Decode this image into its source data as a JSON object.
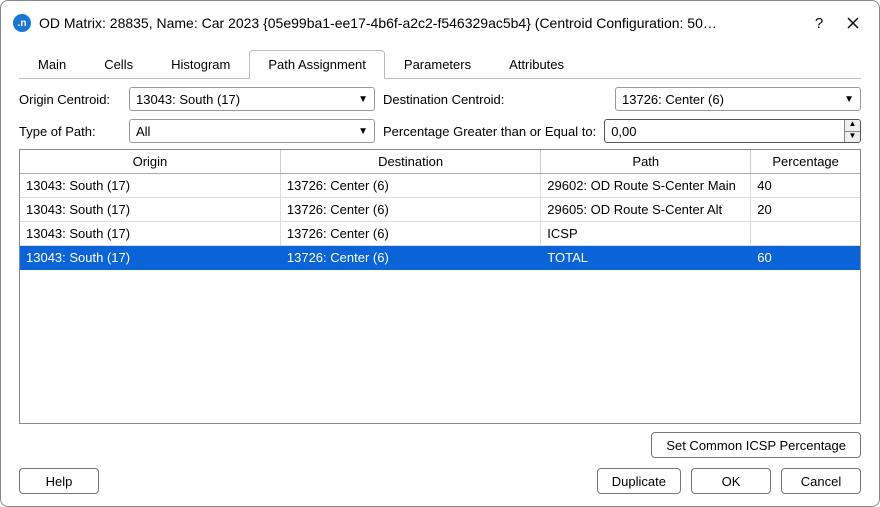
{
  "window": {
    "title": "OD Matrix: 28835, Name: Car 2023  {05e99ba1-ee17-4b6f-a2c2-f546329ac5b4} (Centroid Configuration: 50…"
  },
  "tabs": [
    "Main",
    "Cells",
    "Histogram",
    "Path Assignment",
    "Parameters",
    "Attributes"
  ],
  "activeTab": "Path Assignment",
  "form": {
    "originLabel": "Origin Centroid:",
    "originValue": "13043: South (17)",
    "destLabel": "Destination Centroid:",
    "destValue": "13726: Center (6)",
    "typeLabel": "Type of Path:",
    "typeValue": "All",
    "pctLabel": "Percentage Greater than or Equal to:",
    "pctValue": "0,00"
  },
  "table": {
    "headers": [
      "Origin",
      "Destination",
      "Path",
      "Percentage"
    ],
    "rows": [
      {
        "origin": "13043: South (17)",
        "dest": "13726: Center (6)",
        "path": "29602: OD Route S-Center Main",
        "pct": "40",
        "selected": false
      },
      {
        "origin": "13043: South (17)",
        "dest": "13726: Center (6)",
        "path": "29605: OD Route S-Center Alt",
        "pct": "20",
        "selected": false
      },
      {
        "origin": "13043: South (17)",
        "dest": "13726: Center (6)",
        "path": "ICSP",
        "pct": "",
        "selected": false
      },
      {
        "origin": "13043: South (17)",
        "dest": "13726: Center (6)",
        "path": "TOTAL",
        "pct": "60",
        "selected": true
      }
    ]
  },
  "buttons": {
    "setIcsp": "Set Common ICSP Percentage",
    "help": "Help",
    "duplicate": "Duplicate",
    "ok": "OK",
    "cancel": "Cancel"
  }
}
